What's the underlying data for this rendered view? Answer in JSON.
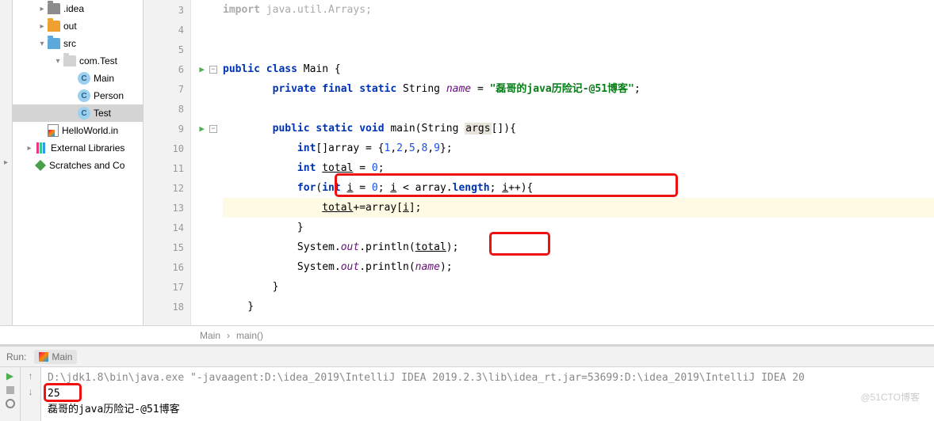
{
  "tree": {
    "idea_folder": ".idea",
    "out_folder": "out",
    "src_folder": "src",
    "package": "com.Test",
    "class_main": "Main",
    "class_person": "Person",
    "class_test": "Test",
    "iml_file": "HelloWorld.in",
    "external_libs": "External Libraries",
    "scratches": "Scratches and Co"
  },
  "code": {
    "import_kw": "import",
    "import_rest": " java.util.Arrays;",
    "l6": {
      "public": "public ",
      "class": "class ",
      "name": "Main {"
    },
    "l7": {
      "indent": "        ",
      "private": "private ",
      "final": "final ",
      "static": "static ",
      "type": "String ",
      "name": "name",
      "eq": " = ",
      "str": "\"磊哥的java历险记-@51博客\"",
      "semi": ";"
    },
    "l9": {
      "indent": "        ",
      "public": "public ",
      "static": "static ",
      "void": "void ",
      "main": "main(String ",
      "args": "args",
      "rest": "[]){"
    },
    "l10": {
      "indent": "            ",
      "int": "int",
      "rest1": "[]array = {",
      "n1": "1",
      "c1": ",",
      "n2": "2",
      "c2": ",",
      "n3": "5",
      "c3": ",",
      "n4": "8",
      "c4": ",",
      "n5": "9",
      "rest2": "};"
    },
    "l11": {
      "indent": "            ",
      "int": "int ",
      "total": "total",
      "rest": " = ",
      "zero": "0",
      "semi": ";"
    },
    "l12": {
      "indent": "            ",
      "for": "for",
      "rest1": "(",
      "int": "int ",
      "i1": "i",
      "rest2": " = ",
      "zero": "0",
      "rest3": "; ",
      "i2": "i",
      "rest4": " < array.",
      "length": "length",
      "rest5": "; ",
      "i3": "i",
      "rest6": "++){"
    },
    "l13": {
      "indent": "                ",
      "total": "total",
      "rest1": "+=array[",
      "i": "i",
      "rest2": "];"
    },
    "l14": {
      "indent": "            }",
      "text": ""
    },
    "l15": {
      "indent": "            System.",
      "out": "out",
      "rest1": ".println(",
      "total": "total",
      "rest2": ");"
    },
    "l16": {
      "indent": "            System.",
      "out": "out",
      "rest1": ".println(",
      "name": "name",
      "rest2": ");"
    },
    "l17": "        }",
    "l18": "    }"
  },
  "line_numbers": [
    "3",
    "4",
    "5",
    "6",
    "7",
    "8",
    "9",
    "10",
    "11",
    "12",
    "13",
    "14",
    "15",
    "16",
    "17",
    "18"
  ],
  "breadcrumb": {
    "a": "Main",
    "sep": "›",
    "b": "main()"
  },
  "run": {
    "label": "Run:",
    "tab": "Main",
    "cmd": "D:\\jdk1.8\\bin\\java.exe \"-javaagent:D:\\idea_2019\\IntelliJ IDEA 2019.2.3\\lib\\idea_rt.jar=53699:D:\\idea_2019\\IntelliJ IDEA 20",
    "out1": "25",
    "out2": "磊哥的java历险记-@51博客"
  },
  "watermark": "@51CTO博客"
}
